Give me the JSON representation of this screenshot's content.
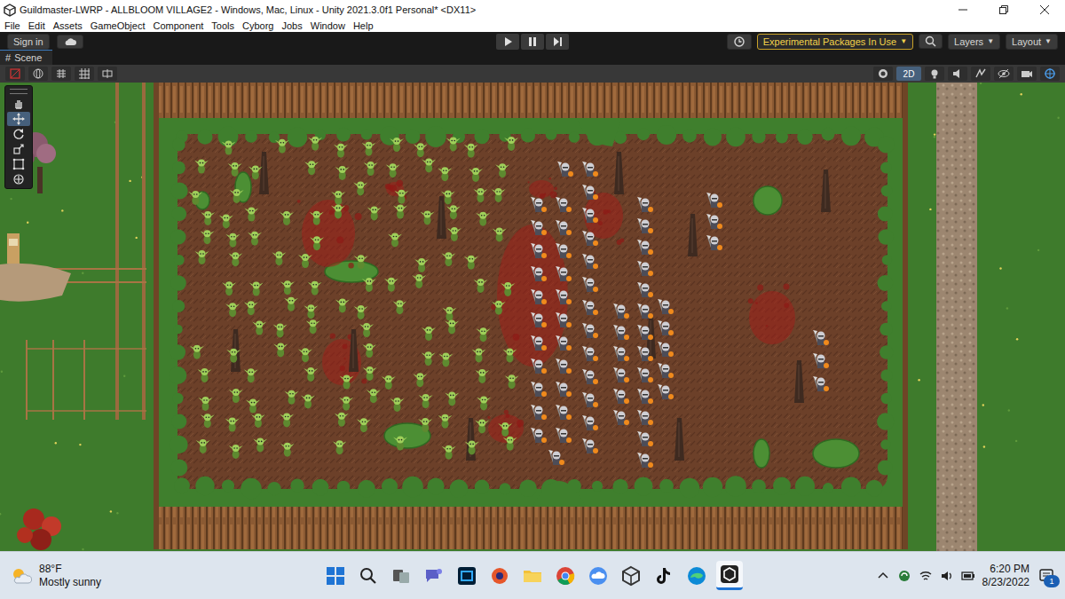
{
  "window": {
    "title": "Guildmaster-LWRP - ALLBLOOM VILLAGE2 - Windows, Mac, Linux - Unity 2021.3.0f1 Personal* <DX11>"
  },
  "menu": [
    "File",
    "Edit",
    "Assets",
    "GameObject",
    "Component",
    "Tools",
    "Cyborg",
    "Jobs",
    "Window",
    "Help"
  ],
  "toolbar": {
    "sign_in": "Sign in",
    "experimental": {
      "label": "Experimental Packages In Use",
      "arrow": "▼"
    },
    "layers": {
      "label": "Layers",
      "arrow": "▼"
    },
    "layout": {
      "label": "Layout",
      "arrow": "▼"
    }
  },
  "scene_tab": {
    "icon": "#",
    "label": "Scene"
  },
  "scene_toolbar": {
    "mode_2d": {
      "label": "2D",
      "selected": true
    }
  },
  "tools": [
    {
      "kind": "hand",
      "selected": false
    },
    {
      "kind": "move",
      "selected": true
    },
    {
      "kind": "rotate",
      "selected": false
    },
    {
      "kind": "scale",
      "selected": false
    },
    {
      "kind": "rect",
      "selected": false
    },
    {
      "kind": "transform",
      "selected": false
    }
  ],
  "taskbar": {
    "weather": {
      "temperature": "88°F",
      "condition": "Mostly sunny"
    },
    "clock": {
      "time": "6:20 PM",
      "date": "8/23/2022"
    },
    "notifications": "1"
  }
}
